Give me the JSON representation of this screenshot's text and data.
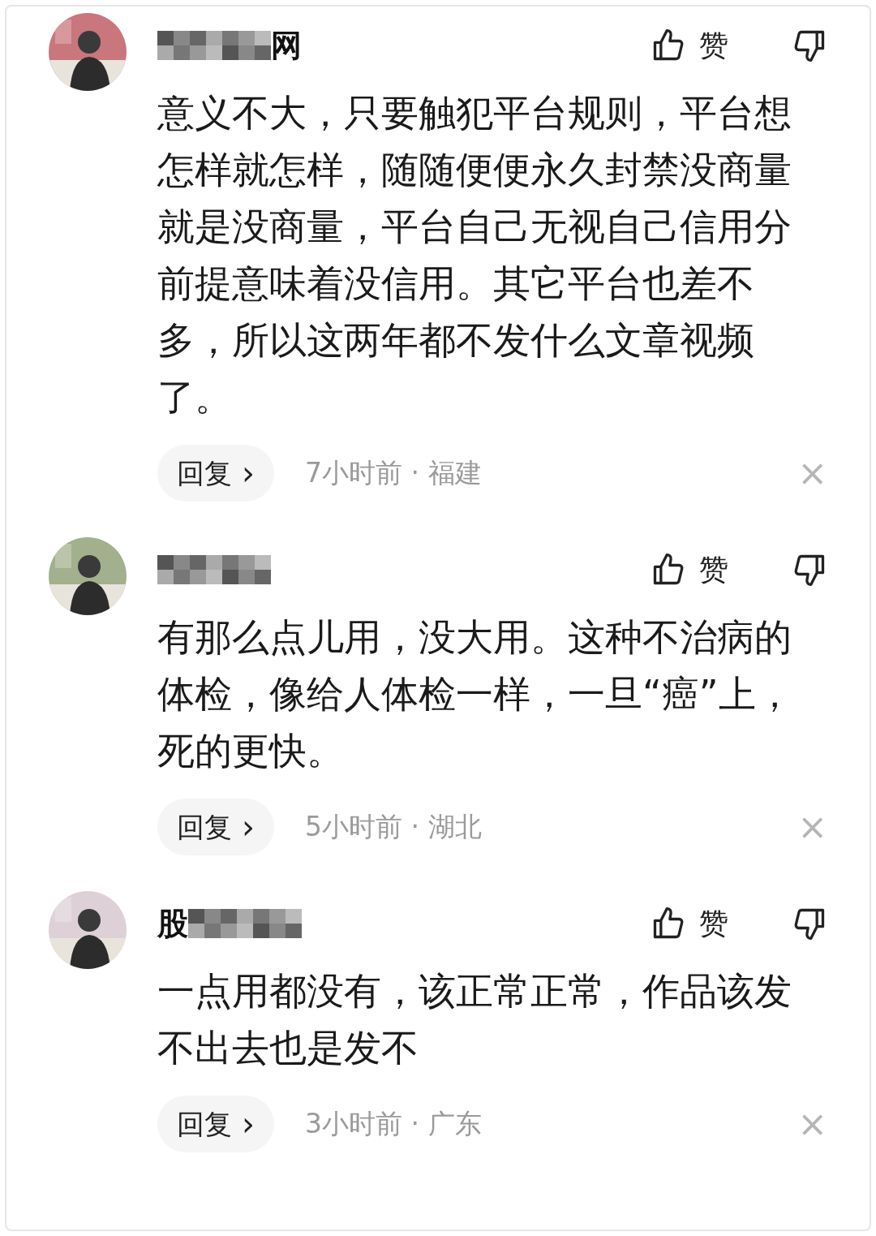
{
  "comments": [
    {
      "avatar": {
        "kind": "picture"
      },
      "name_parts": [
        {
          "kind": "mosaic"
        },
        {
          "kind": "text",
          "text": "网"
        }
      ],
      "like_label": "赞",
      "content": "意义不大，只要触犯平台规则，平台想怎样就怎样，随随便便永久封禁没商量就是没商量，平台自己无视自己信用分前提意味着没信用。其它平台也差不多，所以这两年都不发什么文章视频了。",
      "reply_label": "回复",
      "chevron": "›",
      "time": "7小时前",
      "separator": "·",
      "location": "福建",
      "close": "×"
    },
    {
      "avatar": {
        "kind": "picture"
      },
      "name_parts": [
        {
          "kind": "mosaic"
        }
      ],
      "like_label": "赞",
      "content": "有那么点儿用，没大用。这种不治病的体检，像给人体检一样，一旦“癌”上，死的更快。",
      "reply_label": "回复",
      "chevron": "›",
      "time": "5小时前",
      "separator": "·",
      "location": "湖北",
      "close": "×"
    },
    {
      "avatar": {
        "kind": "picture"
      },
      "name_parts": [
        {
          "kind": "text",
          "text": "股"
        },
        {
          "kind": "mosaic"
        }
      ],
      "like_label": "赞",
      "content": "一点用都没有，该正常正常，作品该发不出去也是发不",
      "reply_label": "回复",
      "chevron": "›",
      "time": "3小时前",
      "separator": "·",
      "location": "广东",
      "close": "×"
    }
  ]
}
